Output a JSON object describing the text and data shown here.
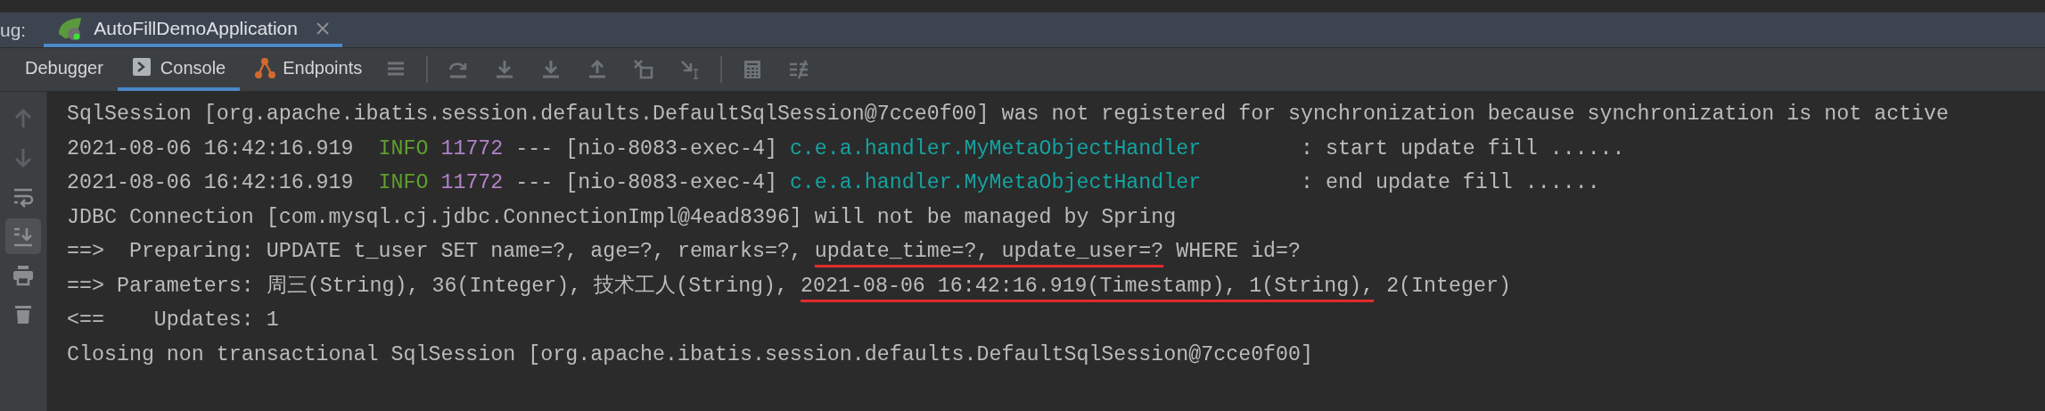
{
  "session_bar": {
    "label": "ug:",
    "tabs": [
      {
        "title": "AutoFillDemoApplication",
        "selected": true
      }
    ]
  },
  "toolbar": {
    "tabs": [
      {
        "label": "Debugger",
        "kind": "plain",
        "selected": false
      },
      {
        "label": "Console",
        "kind": "console",
        "selected": true
      },
      {
        "label": "Endpoints",
        "kind": "endpoints",
        "selected": false
      }
    ],
    "actions": [
      {
        "kind": "menu"
      },
      {
        "kind": "sep"
      },
      {
        "kind": "step-over"
      },
      {
        "kind": "step-into"
      },
      {
        "kind": "force-step-into"
      },
      {
        "kind": "step-out"
      },
      {
        "kind": "drop-frame"
      },
      {
        "kind": "run-to-cursor"
      },
      {
        "kind": "sep"
      },
      {
        "kind": "evaluate"
      },
      {
        "kind": "trace"
      }
    ]
  },
  "gutter": [
    {
      "kind": "up",
      "active": false
    },
    {
      "kind": "down",
      "active": false
    },
    {
      "kind": "wrap",
      "active": false
    },
    {
      "kind": "scroll-end",
      "active": true
    },
    {
      "kind": "print",
      "active": false
    },
    {
      "kind": "trash",
      "active": false
    }
  ],
  "console": {
    "lines": [
      [
        {
          "kind": "plain",
          "text": "SqlSession [org.apache.ibatis.session.defaults.DefaultSqlSession@7cce0f00] was not registered for synchronization because synchronization is not active"
        }
      ],
      [
        {
          "kind": "plain",
          "text": "2021-08-06 16:42:16.919  "
        },
        {
          "kind": "level",
          "text": "INFO "
        },
        {
          "kind": "pid",
          "text": "11772"
        },
        {
          "kind": "plain",
          "text": " --- [nio-8083-exec-4] "
        },
        {
          "kind": "logger",
          "text": "c.e.a.handler.MyMetaObjectHandler"
        },
        {
          "kind": "plain",
          "text": "        : start update fill ......"
        }
      ],
      [
        {
          "kind": "plain",
          "text": "2021-08-06 16:42:16.919  "
        },
        {
          "kind": "level",
          "text": "INFO "
        },
        {
          "kind": "pid",
          "text": "11772"
        },
        {
          "kind": "plain",
          "text": " --- [nio-8083-exec-4] "
        },
        {
          "kind": "logger",
          "text": "c.e.a.handler.MyMetaObjectHandler"
        },
        {
          "kind": "plain",
          "text": "        : end update fill ......"
        }
      ],
      [
        {
          "kind": "plain",
          "text": "JDBC Connection [com.mysql.cj.jdbc.ConnectionImpl@4ead8396] will not be managed by Spring"
        }
      ],
      [
        {
          "kind": "plain",
          "text": "==>  Preparing: UPDATE t_user SET name=?, age=?, remarks=?, "
        },
        {
          "kind": "underlined",
          "text": "update_time=?, update_user=?"
        },
        {
          "kind": "plain",
          "text": " WHERE id=?"
        }
      ],
      [
        {
          "kind": "plain",
          "text": "==> Parameters: 周三(String), 36(Integer), 技术工人(String), "
        },
        {
          "kind": "underlined",
          "text": "2021-08-06 16:42:16.919(Timestamp), 1(String),"
        },
        {
          "kind": "plain",
          "text": " 2(Integer)"
        }
      ],
      [
        {
          "kind": "plain",
          "text": "<==    Updates: 1"
        }
      ],
      [
        {
          "kind": "plain",
          "text": "Closing non transactional SqlSession [org.apache.ibatis.session.defaults.DefaultSqlSession@7cce0f00]"
        }
      ]
    ]
  }
}
